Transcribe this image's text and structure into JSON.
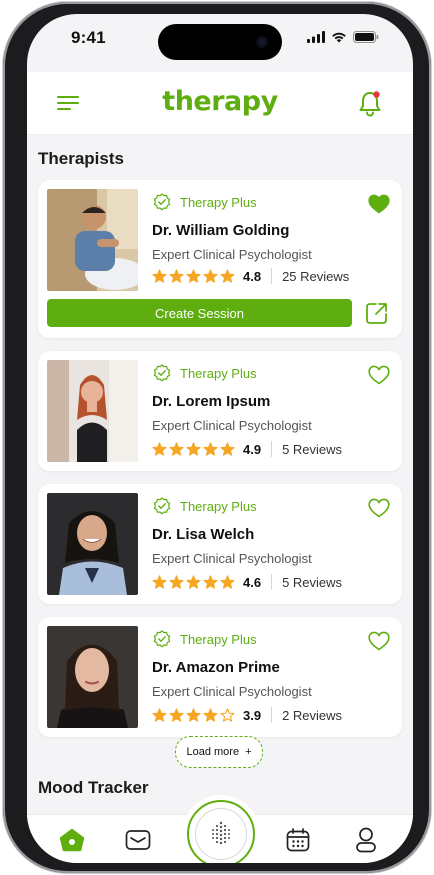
{
  "status": {
    "time": "9:41"
  },
  "header": {
    "logo": "therapy"
  },
  "sections": {
    "therapists_title": "Therapists",
    "mood_title": "Mood Tracker"
  },
  "therapists": [
    {
      "badge": "Therapy Plus",
      "name": "Dr.  William Golding",
      "role": "Expert Clinical Psychologist",
      "rating": "4.8",
      "stars": 5,
      "reviews": "25 Reviews",
      "favorite": true,
      "action_label": "Create Session"
    },
    {
      "badge": "Therapy Plus",
      "name": "Dr.  Lorem Ipsum",
      "role": "Expert Clinical Psychologist",
      "rating": "4.9",
      "stars": 5,
      "reviews": "5 Reviews",
      "favorite": false
    },
    {
      "badge": "Therapy Plus",
      "name": "Dr. Lisa Welch",
      "role": "Expert Clinical Psychologist",
      "rating": "4.6",
      "stars": 5,
      "reviews": "5 Reviews",
      "favorite": false
    },
    {
      "badge": "Therapy Plus",
      "name": "Dr. Amazon Prime",
      "role": "Expert Clinical Psychologist",
      "rating": "3.9",
      "stars": 4,
      "reviews": "2 Reviews",
      "favorite": false
    }
  ],
  "load_more": {
    "label": "Load more",
    "icon": "+"
  },
  "tabbar": {
    "items": [
      "home-icon",
      "mail-icon",
      "breathe-icon",
      "calendar-icon",
      "profile-icon"
    ],
    "active": "home-icon"
  },
  "colors": {
    "brand": "#5fae10",
    "star": "#f5a623",
    "notification_dot": "#e53935"
  }
}
